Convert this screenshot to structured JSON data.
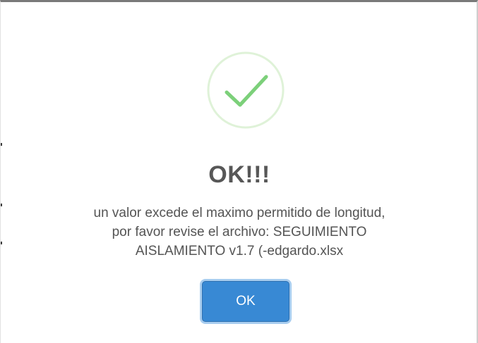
{
  "dialog": {
    "icon": "success-checkmark-icon",
    "title": "OK!!!",
    "message_lines": [
      "un valor excede el maximo permitido de longitud,",
      "por favor revise el archivo: SEGUIMIENTO",
      "AISLAMIENTO v1.7 (-edgardo.xlsx"
    ],
    "confirm_label": "OK"
  },
  "colors": {
    "success_green": "#7cd07a",
    "success_ring": "#dff2d8",
    "button_blue": "#3889d4",
    "button_focus_ring": "#a8cdef",
    "title_text": "#575757",
    "body_text": "#545454"
  }
}
